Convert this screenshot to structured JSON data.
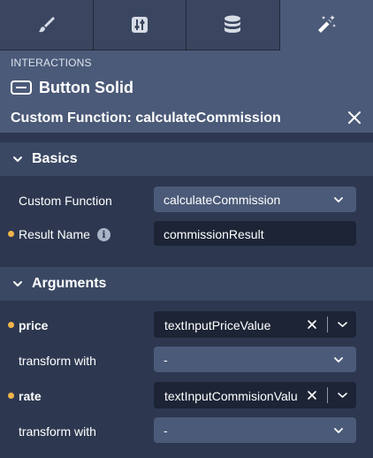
{
  "tabs": [
    {
      "icon": "paintbrush-icon",
      "active": false
    },
    {
      "icon": "sliders-icon",
      "active": false
    },
    {
      "icon": "database-icon",
      "active": false
    },
    {
      "icon": "magic-wand-icon",
      "active": true
    }
  ],
  "header": {
    "section_label": "INTERACTIONS",
    "component_icon": "button-icon",
    "component_title": "Button Solid",
    "function_title": "Custom Function: calculateCommission",
    "close_icon": "close-icon"
  },
  "basics": {
    "title": "Basics",
    "custom_function_label": "Custom Function",
    "custom_function_value": "calculateCommission",
    "result_name_label": "Result Name",
    "result_name_value": "commissionResult"
  },
  "arguments": {
    "title": "Arguments",
    "items": [
      {
        "label": "price",
        "value": "textInputPriceValue",
        "transform_label": "transform with",
        "transform_value": "-"
      },
      {
        "label": "rate",
        "value": "textInputCommisionValue",
        "transform_label": "transform with",
        "transform_value": "-"
      }
    ]
  },
  "colors": {
    "panel_bg": "#2d3850",
    "header_bg": "#4b5a78",
    "group_bg": "#3b4863",
    "input_bg": "#1c2435",
    "required_dot": "#f0b54a"
  }
}
